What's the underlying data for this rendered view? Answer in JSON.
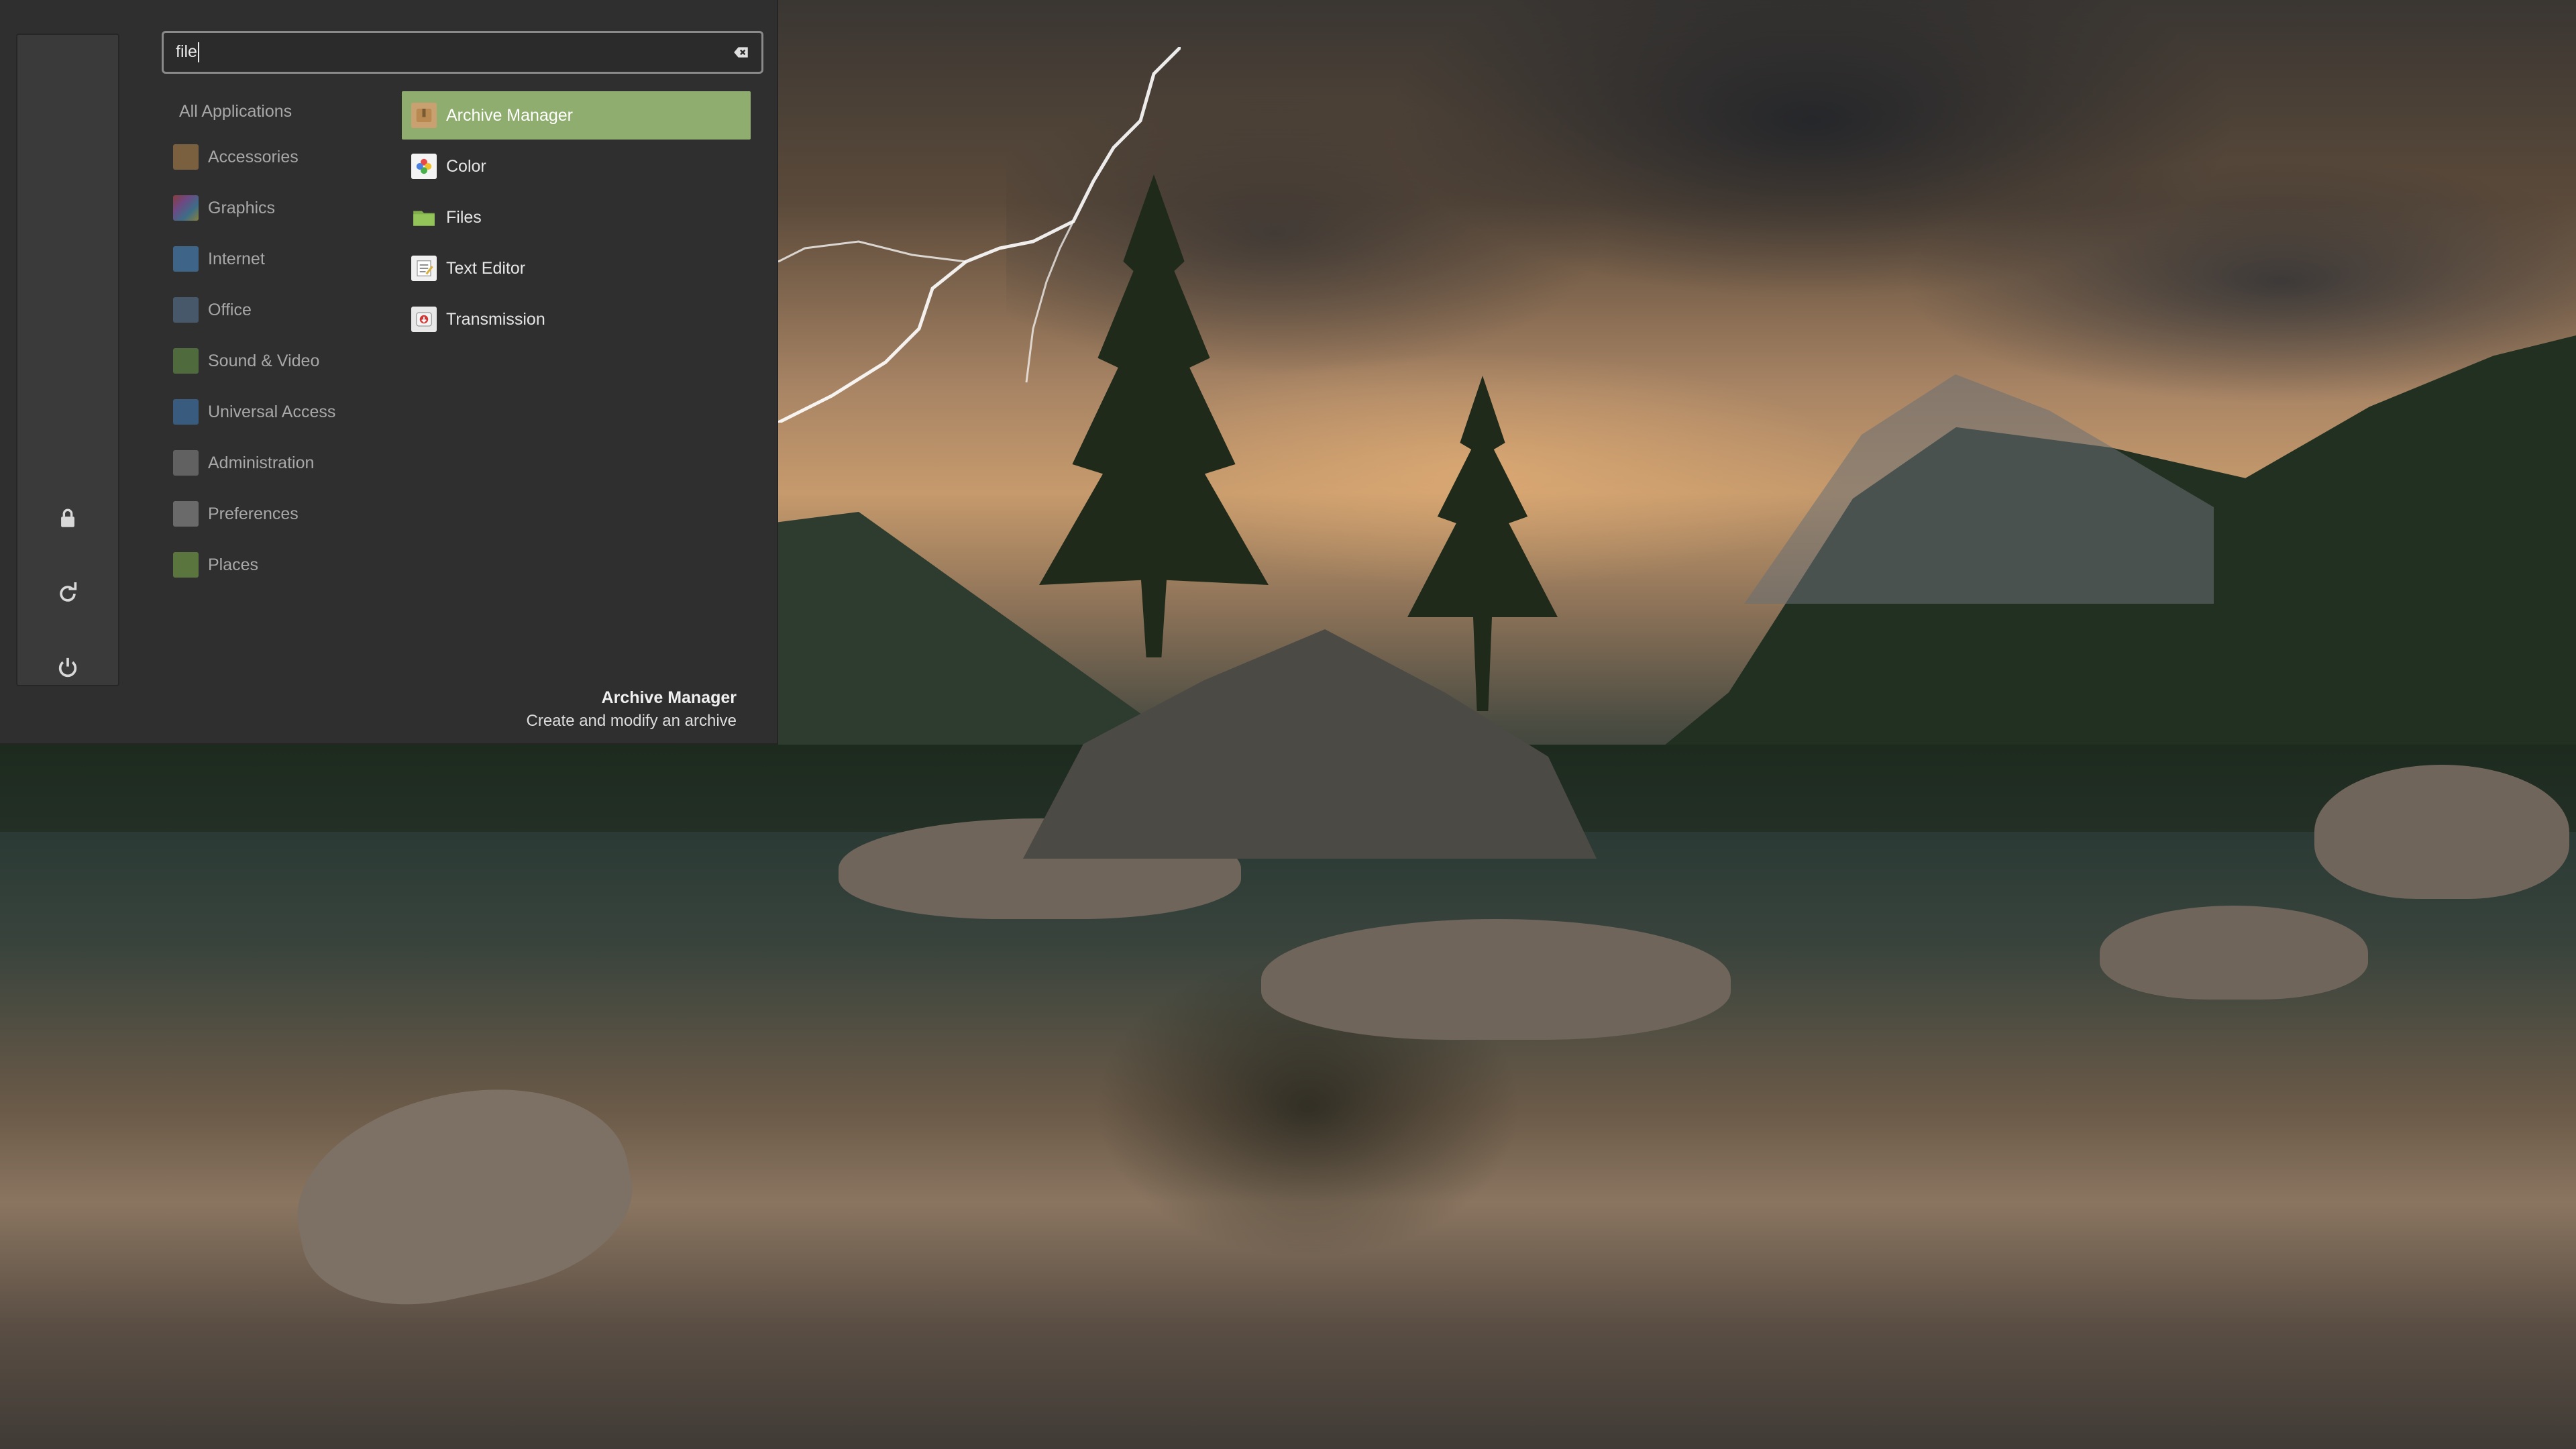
{
  "search": {
    "value": "file"
  },
  "favorites": [
    {
      "name": "lock-icon"
    },
    {
      "name": "logout-icon"
    },
    {
      "name": "power-icon"
    }
  ],
  "categories": [
    {
      "label": "All Applications",
      "icon": ""
    },
    {
      "label": "Accessories",
      "icon": "accessories-icon",
      "color": "#b8894a"
    },
    {
      "label": "Graphics",
      "icon": "graphics-icon",
      "color": "#a05ec8"
    },
    {
      "label": "Internet",
      "icon": "internet-icon",
      "color": "#4a8fd0"
    },
    {
      "label": "Office",
      "icon": "office-icon",
      "color": "#5a7a9a"
    },
    {
      "label": "Sound & Video",
      "icon": "sound-video-icon",
      "color": "#6a9a48"
    },
    {
      "label": "Universal Access",
      "icon": "universal-access-icon",
      "color": "#3f7fc0"
    },
    {
      "label": "Administration",
      "icon": "administration-icon",
      "color": "#8a8a8a"
    },
    {
      "label": "Preferences",
      "icon": "preferences-icon",
      "color": "#9a9a9a"
    },
    {
      "label": "Places",
      "icon": "folder-icon",
      "color": "#7fae4a"
    }
  ],
  "apps": [
    {
      "label": "Archive Manager",
      "icon": "archive-icon",
      "selected": true
    },
    {
      "label": "Color",
      "icon": "color-icon",
      "selected": false
    },
    {
      "label": "Files",
      "icon": "folder-icon",
      "selected": false
    },
    {
      "label": "Text Editor",
      "icon": "text-editor-icon",
      "selected": false
    },
    {
      "label": "Transmission",
      "icon": "transmission-icon",
      "selected": false
    }
  ],
  "description": {
    "title": "Archive Manager",
    "subtitle": "Create and modify an archive"
  },
  "colors": {
    "selection": "#8fad6e",
    "panel": "#2f2f2f"
  }
}
